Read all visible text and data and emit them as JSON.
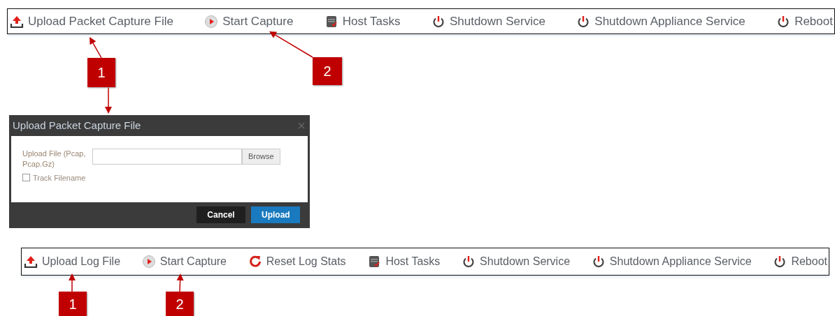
{
  "toolbars": [
    {
      "items": [
        {
          "kind": "upload",
          "label": "Upload Packet Capture File"
        },
        {
          "kind": "play",
          "label": "Start Capture"
        },
        {
          "kind": "server",
          "label": "Host Tasks"
        },
        {
          "kind": "power",
          "label": "Shutdown Service"
        },
        {
          "kind": "power",
          "label": "Shutdown Appliance Service"
        },
        {
          "kind": "power",
          "label": "Reboot"
        }
      ]
    },
    {
      "items": [
        {
          "kind": "upload",
          "label": "Upload Log File"
        },
        {
          "kind": "play",
          "label": "Start Capture"
        },
        {
          "kind": "reset",
          "label": "Reset Log Stats"
        },
        {
          "kind": "server",
          "label": "Host Tasks"
        },
        {
          "kind": "power",
          "label": "Shutdown Service"
        },
        {
          "kind": "power",
          "label": "Shutdown Appliance Service"
        },
        {
          "kind": "power",
          "label": "Reboot"
        }
      ]
    }
  ],
  "dialog": {
    "title": "Upload Packet Capture File",
    "close": "×",
    "field_label": "Upload File (Pcap, Pcap.Gz)",
    "browse": "Browse",
    "checkbox": {
      "label": "Track Filename",
      "checked": false
    },
    "buttons": [
      {
        "kind": "secondary",
        "label": "Cancel"
      },
      {
        "kind": "primary",
        "label": "Upload"
      }
    ]
  },
  "callouts": [
    "1",
    "2",
    "1",
    "2"
  ]
}
